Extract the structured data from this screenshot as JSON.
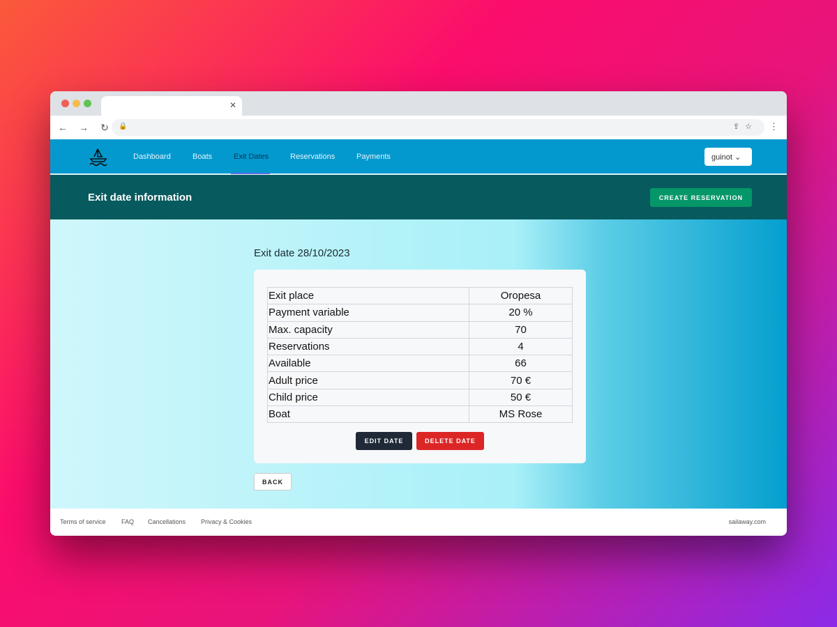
{
  "nav": {
    "items": [
      "Dashboard",
      "Boats",
      "Exit Dates",
      "Reservations",
      "Payments"
    ],
    "user": "guinot"
  },
  "header": {
    "title": "Exit date information",
    "create_label": "CREATE RESERVATION"
  },
  "main": {
    "title": "Exit date 28/10/2023",
    "rows": [
      [
        "Exit place",
        "Oropesa"
      ],
      [
        "Payment variable",
        "20 %"
      ],
      [
        "Max. capacity",
        "70"
      ],
      [
        "Reservations",
        "4"
      ],
      [
        "Available",
        "66"
      ],
      [
        "Adult price",
        "70 €"
      ],
      [
        "Child price",
        "50 €"
      ],
      [
        "Boat",
        "MS Rose"
      ]
    ],
    "edit_label": "EDIT DATE",
    "delete_label": "DELETE DATE",
    "back_label": "BACK"
  },
  "footer": {
    "links": [
      "Terms of service",
      "FAQ",
      "Cancellations",
      "Privacy & Cookies"
    ],
    "site": "sailaway.com"
  }
}
